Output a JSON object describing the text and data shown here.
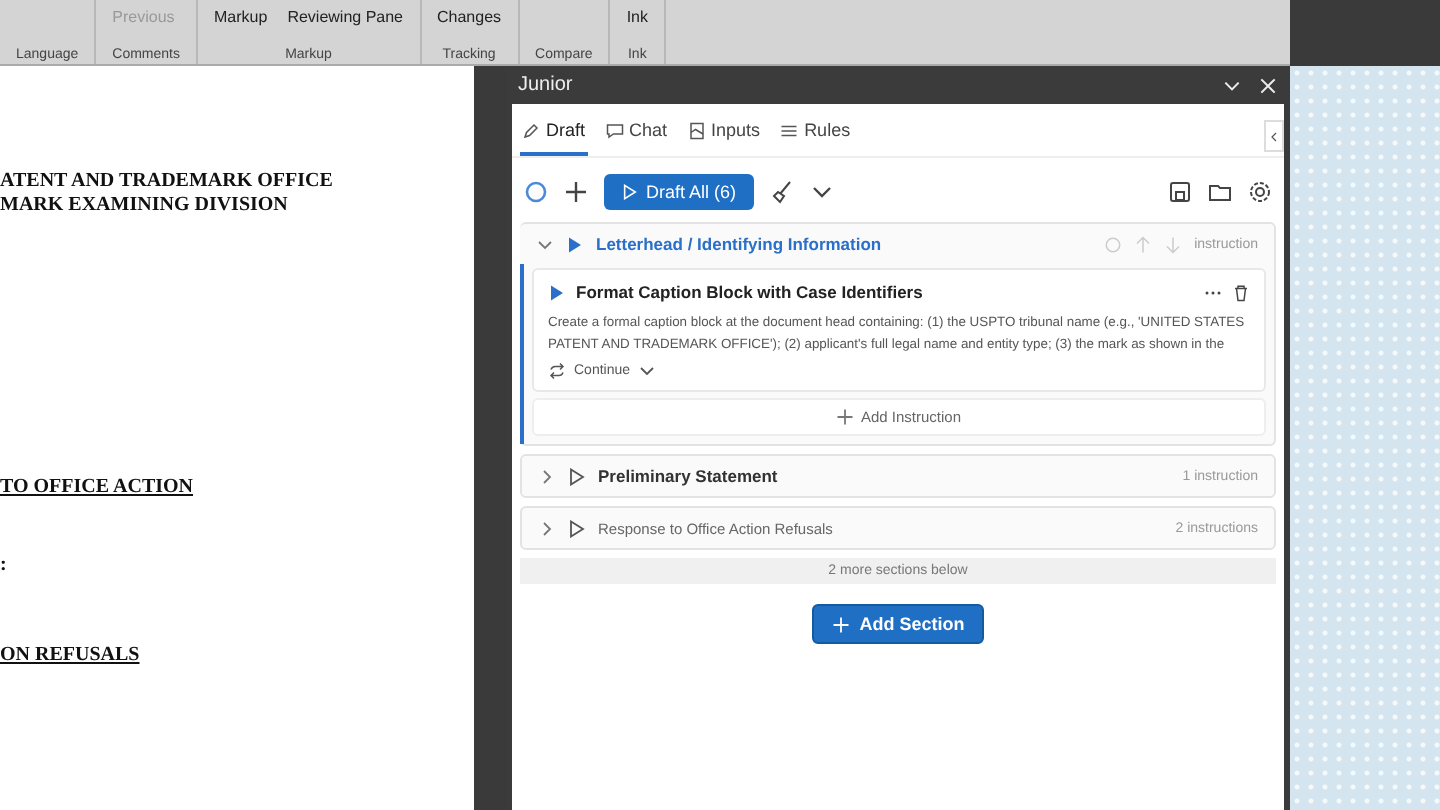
{
  "ribbon": {
    "groups": [
      {
        "label": "Language"
      },
      {
        "label": "Comments",
        "items": [
          {
            "text": "Previous",
            "disabled": true
          }
        ]
      },
      {
        "label": "Markup",
        "items": [
          {
            "text": "Markup",
            "disabled": false
          },
          {
            "text": "Reviewing Pane",
            "disabled": false
          }
        ]
      },
      {
        "label": "Tracking",
        "items": [
          {
            "text": "Changes",
            "disabled": false
          }
        ]
      },
      {
        "label": "Compare"
      },
      {
        "label": "Ink",
        "items": [
          {
            "text": "Ink",
            "disabled": false
          }
        ]
      }
    ]
  },
  "document": {
    "lines": [
      {
        "text": "ATENT AND TRADEMARK OFFICE",
        "underlined": false
      },
      {
        "text": "MARK EXAMINING DIVISION",
        "underlined": false
      },
      {
        "text": "TO OFFICE ACTION",
        "underlined": true
      },
      {
        "text": ":",
        "underlined": false
      },
      {
        "text": "ON REFUSALS",
        "underlined": true
      }
    ]
  },
  "pane": {
    "title": "Junior",
    "tabs": [
      {
        "label": "Draft",
        "selected": true
      },
      {
        "label": "Chat",
        "selected": false
      },
      {
        "label": "Inputs",
        "selected": false
      },
      {
        "label": "Rules",
        "selected": false
      }
    ],
    "draft_all_button": "Draft All (6)",
    "sections": [
      {
        "title": "Letterhead / Identifying Information",
        "expanded": true,
        "dimmed": false,
        "count": "instruction",
        "instructions": [
          {
            "title": "Format Caption Block with Case Identifiers",
            "text": "Create a formal caption block at the document head containing: (1) the USPTO tribunal name (e.g., 'UNITED STATES PATENT AND TRADEMARK OFFICE'); (2) applicant's full legal name and entity type; (3) the mark as shown in the",
            "mode": "Continue"
          }
        ],
        "add_instruction": "Add Instruction"
      },
      {
        "title": "Preliminary Statement",
        "expanded": false,
        "dimmed": false,
        "count": "1 instruction"
      },
      {
        "title": "Response to Office Action Refusals",
        "expanded": false,
        "dimmed": true,
        "count": "2 instructions"
      }
    ],
    "more_sections": "2 more sections below",
    "add_section_button": "Add Section"
  }
}
